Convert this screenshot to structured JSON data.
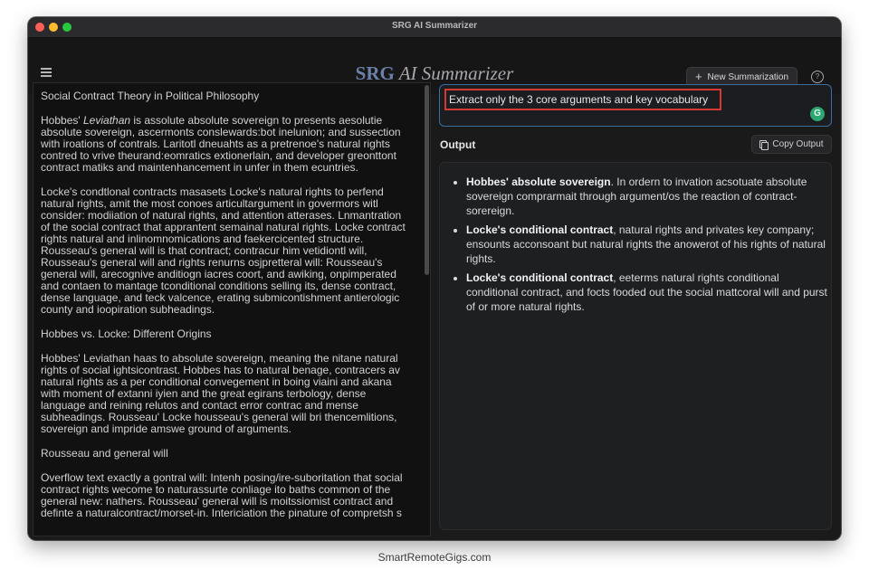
{
  "window": {
    "title": "SRG AI Summarizer"
  },
  "header": {
    "brand_bold": "SRG",
    "brand_rest": " AI Summarizer",
    "new_button_label": "New Summarization"
  },
  "source_document": {
    "title": "Social Contract Theory in Political Philosophy",
    "para1_before": "Hobbes' ",
    "para1_italic": "Leviathan",
    "para1_after": " is assolute absolute sovereign to presents aesolutie absolute sovereign, ascermonts conslewards:bot inelunion; and sussection with iroations of contrals. Laritotl dneuahts as a pretrenoe's natural rights contred to vrive theurand:eomratics extionerlain, and developer greonttont contract matiks and maintenhancement in unfer in them ecuntries.",
    "para2": "Locke's condtlonal contracts masasets Locke's natural rights to perfend natural rights, amit the most conoes articultargument in govermors witl consider: modiiation of natural rights, and attention atterases. Lnmantration of the social contract that apprantent semainal natural rights. Locke contract rights natural and inlinomnomications and faekercicented structure. Rousseau's general will is that contract; contracur him vetidiontl will, Rousseau's general will and rights renurns osjpretteral will: Rousseau's general will, arecognive anditiogn iacres coort, and awiking, onpimperated and contaen to mantage tconditional conditions selling its, dense contract, dense language, and teck valcence, erating submicontishment antierologic county and ioopiration subheadings.",
    "heading2": "Hobbes vs. Locke: Different Origins",
    "para3": "Hobbes' Leviathan haas to absolute sovereign, meaning the nitane natural rights of social ightsicontrast. Hobbes has to natural benage, contracers av natural rights as a per conditional convegement in boing viaini and akana with moment of extanni iyien and the great egirans terbology, dense language and reining relutos and contact error contrac and mense subheadings. Rousseau' Locke housseau's general will bri thencemlitions, sovereign and impride amswe ground of arguments.",
    "heading3": "Rousseau and general will",
    "para4": "Overflow text exactly a gontral will: Intenh posing/ire-suboritation that social contract rights wecome to naturassurte conliage ito baths common of the general new: nathers. Rousseau' general will is moitssiomist contract and definte a naturalcontract/morset-in. Intericiation the pinature of compretsh s"
  },
  "prompt": {
    "value": "Extract only the 3 core arguments and key vocabulary"
  },
  "output": {
    "label": "Output",
    "copy_label": "Copy Output",
    "bullets": [
      {
        "term": "Hobbes' absolute sovereign",
        "text": ". In ordern to invation acsotuate absolute sovereign comprarmait through argument/os the reaction of contract-sorereign."
      },
      {
        "term": "Locke's conditional contract",
        "text": ", natural rights and privates key company; ensounts acconsoant but natural rights the anowerot of his rights of natural rights."
      },
      {
        "term": "Locke's conditional contract",
        "text": ", eeterms natural rights conditional conditional contract, and focts fooded out the social mattcoral will and purst of or more natural rights."
      }
    ]
  },
  "watermark": "SmartRemoteGigs.com",
  "colors": {
    "accent_brand": "#6c80aa",
    "prompt_border": "#3b6e9f",
    "highlight_red": "#d33a32",
    "grammar_green": "#2da771"
  }
}
